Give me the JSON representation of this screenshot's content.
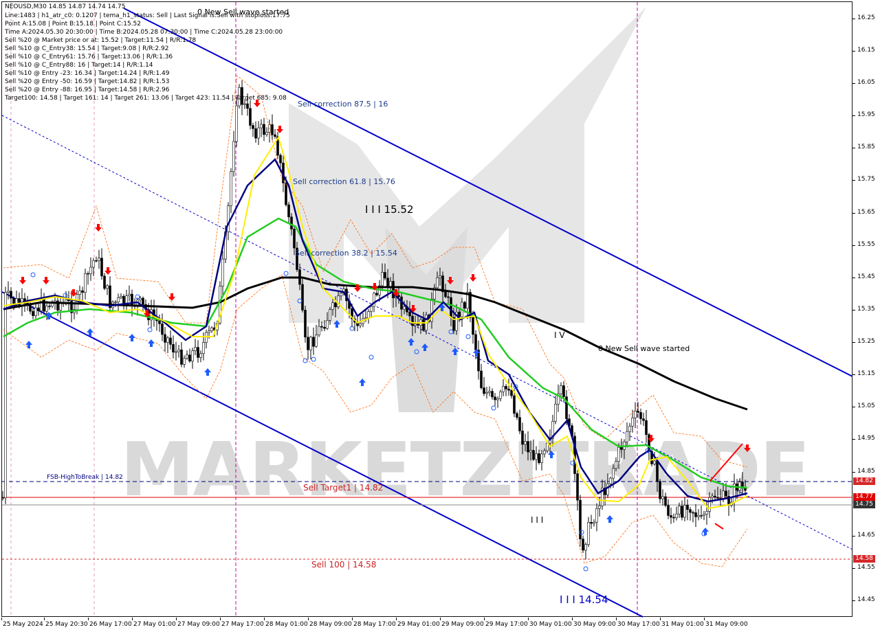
{
  "header": {
    "symbol_line": "NEOUSD,M30  14.85 14.87 14.74 14.75",
    "info_lines": [
      "Line:1483 | h1_atr_c0: 0.1207 | tema_h1_status: Sell | Last Signal is:Sell with stoploss:17.75",
      "Point A:15.08 | Point B:15.18 | Point C:15.52",
      "Time A:2024.05.30 20:30:00 | Time B:2024.05.28 07:30:00 | Time C:2024.05.28 23:00:00",
      "Sell %20 @ Market price or at: 15.52 | Target:11.54 | R/R:1.78",
      "Sell %10 @ C_Entry38: 15.54 | Target:9.08 | R/R:2.92",
      "Sell %10 @ C_Entry61: 15.76 | Target:13.06 | R/R:1.36",
      "Sell %10 @ C_Entry88: 16 | Target:14 | R/R:1.14",
      "Sell %10 @ Entry -23: 16.34 | Target:14.24 | R/R:1.49",
      "Sell %20 @ Entry -50: 16.59 | Target:14.82 | R/R:1.53",
      "Sell %20 @ Entry -88: 16.95 | Target:14.58 | R/R:2.96",
      "Target100: 14.58 | Target 161: 14 | Target 261: 13.06 | Target 423: 11.54 | Target 685: 9.08"
    ]
  },
  "annotations": {
    "new_sell_wave_top": "0 New Sell wave started",
    "new_sell_wave_mid": "0 New Sell wave started",
    "sell_correction_875": "Sell correction 87.5 | 16",
    "sell_correction_618": "Sell correction 61.8 | 15.76",
    "sell_correction_382": "Sell correction 38.2 | 15.54",
    "wave_iii_label": "I I I 15.52",
    "wave_iv_label": "I V",
    "wave_iii_low_label": "I I I 14.54",
    "wave_ii_label": "I I I",
    "fsb_label": "FSB-HighToBreak | 14.82",
    "sell_target1": "Sell Target1 | 14.82",
    "sell_100": "Sell 100 | 14.58"
  },
  "watermark": "MARKETZITRADE",
  "price_axis": {
    "ticks": [
      "16.25",
      "16.15",
      "16.05",
      "15.95",
      "15.85",
      "15.75",
      "15.65",
      "15.55",
      "15.45",
      "15.35",
      "15.25",
      "15.15",
      "15.05",
      "14.95",
      "14.85",
      "14.65",
      "14.55",
      "14.45"
    ],
    "markers": [
      {
        "label": "14.82",
        "color": "#d62728"
      },
      {
        "label": "14.77",
        "color": "#e00000"
      },
      {
        "label": "14.75",
        "color": "#333333"
      },
      {
        "label": "14.58",
        "color": "#d62728"
      }
    ]
  },
  "time_axis": {
    "labels": [
      "25 May 2024",
      "25 May 20:30",
      "26 May 17:00",
      "27 May 01:00",
      "27 May 09:00",
      "27 May 17:00",
      "28 May 01:00",
      "28 May 09:00",
      "28 May 17:00",
      "29 May 01:00",
      "29 May 09:00",
      "29 May 17:00",
      "30 May 01:00",
      "30 May 09:00",
      "30 May 17:00",
      "31 May 01:00",
      "31 May 09:00"
    ]
  },
  "colors": {
    "channel": "#0000cc",
    "ema_black": "#000000",
    "ema_green": "#22cc22",
    "ema_navy": "#000080",
    "ema_yellow": "#ffee00",
    "envelope": "#ff6600",
    "sell_arrow": "#ff0000",
    "buy_arrow": "#1e5bff",
    "target_line": "#e00000"
  }
}
